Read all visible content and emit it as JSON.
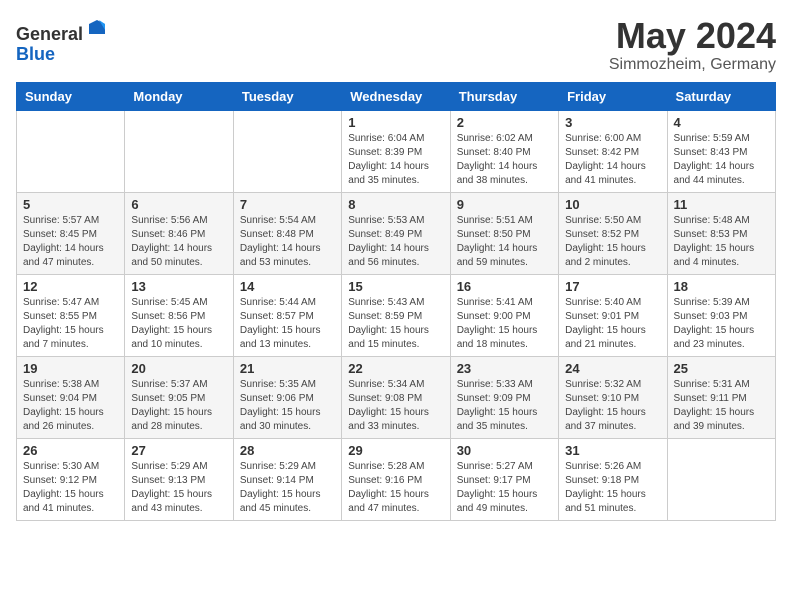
{
  "header": {
    "logo_line1": "General",
    "logo_line2": "Blue",
    "month_year": "May 2024",
    "location": "Simmozheim, Germany"
  },
  "days_of_week": [
    "Sunday",
    "Monday",
    "Tuesday",
    "Wednesday",
    "Thursday",
    "Friday",
    "Saturday"
  ],
  "weeks": [
    [
      {
        "day": "",
        "detail": ""
      },
      {
        "day": "",
        "detail": ""
      },
      {
        "day": "",
        "detail": ""
      },
      {
        "day": "1",
        "detail": "Sunrise: 6:04 AM\nSunset: 8:39 PM\nDaylight: 14 hours and 35 minutes."
      },
      {
        "day": "2",
        "detail": "Sunrise: 6:02 AM\nSunset: 8:40 PM\nDaylight: 14 hours and 38 minutes."
      },
      {
        "day": "3",
        "detail": "Sunrise: 6:00 AM\nSunset: 8:42 PM\nDaylight: 14 hours and 41 minutes."
      },
      {
        "day": "4",
        "detail": "Sunrise: 5:59 AM\nSunset: 8:43 PM\nDaylight: 14 hours and 44 minutes."
      }
    ],
    [
      {
        "day": "5",
        "detail": "Sunrise: 5:57 AM\nSunset: 8:45 PM\nDaylight: 14 hours and 47 minutes."
      },
      {
        "day": "6",
        "detail": "Sunrise: 5:56 AM\nSunset: 8:46 PM\nDaylight: 14 hours and 50 minutes."
      },
      {
        "day": "7",
        "detail": "Sunrise: 5:54 AM\nSunset: 8:48 PM\nDaylight: 14 hours and 53 minutes."
      },
      {
        "day": "8",
        "detail": "Sunrise: 5:53 AM\nSunset: 8:49 PM\nDaylight: 14 hours and 56 minutes."
      },
      {
        "day": "9",
        "detail": "Sunrise: 5:51 AM\nSunset: 8:50 PM\nDaylight: 14 hours and 59 minutes."
      },
      {
        "day": "10",
        "detail": "Sunrise: 5:50 AM\nSunset: 8:52 PM\nDaylight: 15 hours and 2 minutes."
      },
      {
        "day": "11",
        "detail": "Sunrise: 5:48 AM\nSunset: 8:53 PM\nDaylight: 15 hours and 4 minutes."
      }
    ],
    [
      {
        "day": "12",
        "detail": "Sunrise: 5:47 AM\nSunset: 8:55 PM\nDaylight: 15 hours and 7 minutes."
      },
      {
        "day": "13",
        "detail": "Sunrise: 5:45 AM\nSunset: 8:56 PM\nDaylight: 15 hours and 10 minutes."
      },
      {
        "day": "14",
        "detail": "Sunrise: 5:44 AM\nSunset: 8:57 PM\nDaylight: 15 hours and 13 minutes."
      },
      {
        "day": "15",
        "detail": "Sunrise: 5:43 AM\nSunset: 8:59 PM\nDaylight: 15 hours and 15 minutes."
      },
      {
        "day": "16",
        "detail": "Sunrise: 5:41 AM\nSunset: 9:00 PM\nDaylight: 15 hours and 18 minutes."
      },
      {
        "day": "17",
        "detail": "Sunrise: 5:40 AM\nSunset: 9:01 PM\nDaylight: 15 hours and 21 minutes."
      },
      {
        "day": "18",
        "detail": "Sunrise: 5:39 AM\nSunset: 9:03 PM\nDaylight: 15 hours and 23 minutes."
      }
    ],
    [
      {
        "day": "19",
        "detail": "Sunrise: 5:38 AM\nSunset: 9:04 PM\nDaylight: 15 hours and 26 minutes."
      },
      {
        "day": "20",
        "detail": "Sunrise: 5:37 AM\nSunset: 9:05 PM\nDaylight: 15 hours and 28 minutes."
      },
      {
        "day": "21",
        "detail": "Sunrise: 5:35 AM\nSunset: 9:06 PM\nDaylight: 15 hours and 30 minutes."
      },
      {
        "day": "22",
        "detail": "Sunrise: 5:34 AM\nSunset: 9:08 PM\nDaylight: 15 hours and 33 minutes."
      },
      {
        "day": "23",
        "detail": "Sunrise: 5:33 AM\nSunset: 9:09 PM\nDaylight: 15 hours and 35 minutes."
      },
      {
        "day": "24",
        "detail": "Sunrise: 5:32 AM\nSunset: 9:10 PM\nDaylight: 15 hours and 37 minutes."
      },
      {
        "day": "25",
        "detail": "Sunrise: 5:31 AM\nSunset: 9:11 PM\nDaylight: 15 hours and 39 minutes."
      }
    ],
    [
      {
        "day": "26",
        "detail": "Sunrise: 5:30 AM\nSunset: 9:12 PM\nDaylight: 15 hours and 41 minutes."
      },
      {
        "day": "27",
        "detail": "Sunrise: 5:29 AM\nSunset: 9:13 PM\nDaylight: 15 hours and 43 minutes."
      },
      {
        "day": "28",
        "detail": "Sunrise: 5:29 AM\nSunset: 9:14 PM\nDaylight: 15 hours and 45 minutes."
      },
      {
        "day": "29",
        "detail": "Sunrise: 5:28 AM\nSunset: 9:16 PM\nDaylight: 15 hours and 47 minutes."
      },
      {
        "day": "30",
        "detail": "Sunrise: 5:27 AM\nSunset: 9:17 PM\nDaylight: 15 hours and 49 minutes."
      },
      {
        "day": "31",
        "detail": "Sunrise: 5:26 AM\nSunset: 9:18 PM\nDaylight: 15 hours and 51 minutes."
      },
      {
        "day": "",
        "detail": ""
      }
    ]
  ]
}
